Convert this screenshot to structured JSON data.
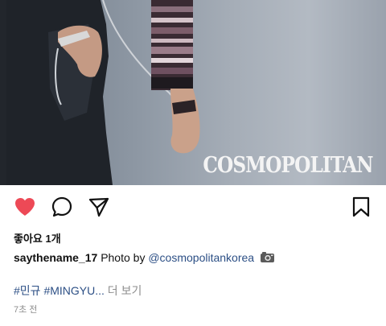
{
  "post": {
    "image": {
      "brand": "COSMOPOLITAN"
    },
    "actions": {
      "like_icon": "heart-filled-icon",
      "comment_icon": "comment-icon",
      "share_icon": "paper-plane-icon",
      "save_icon": "bookmark-icon",
      "like_color": "#ed4956"
    },
    "likes_text": "좋아요 1개",
    "caption": {
      "username": "saythename_17",
      "text": "Photo by",
      "mention": "@cosmopolitankorea",
      "emoji": "camera-emoji"
    },
    "hashtags": [
      "#민규",
      "#MINGYU..."
    ],
    "more_label": "더 보기",
    "timestamp": "7초 전"
  }
}
